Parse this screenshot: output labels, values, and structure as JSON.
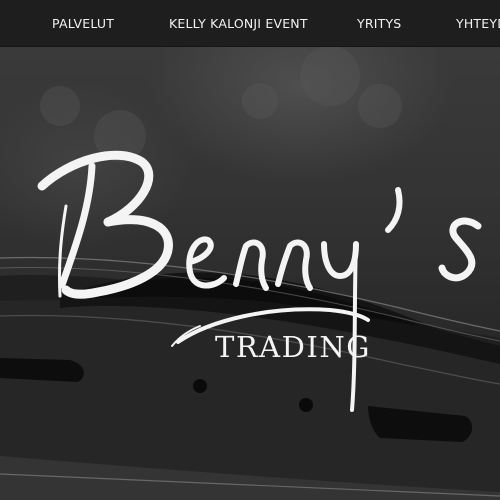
{
  "nav": {
    "items": [
      {
        "label": "PALVELUT"
      },
      {
        "label": "KELLY KALONJI EVENT"
      },
      {
        "label": "YRITYS"
      },
      {
        "label": "YHTEYD"
      }
    ]
  },
  "hero": {
    "logo_script": "Benny's",
    "tagline": "TRADING"
  },
  "colors": {
    "nav_background": "#1e1e1e",
    "nav_text": "#f2f2f2",
    "logo": "#f4f4f4"
  }
}
